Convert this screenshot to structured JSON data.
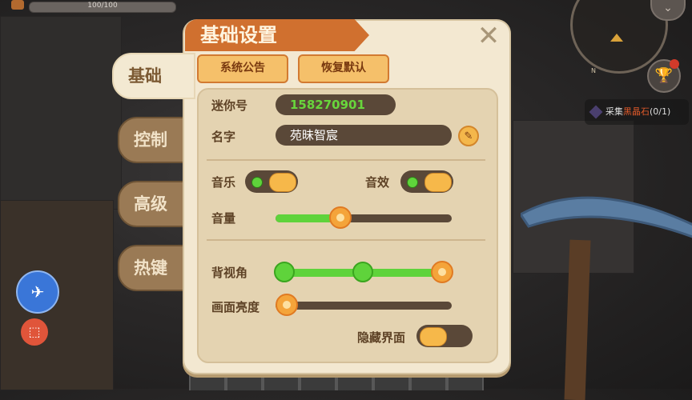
{
  "hud": {
    "health_text": "100/100",
    "compass_label": "N",
    "quest": {
      "prefix": "采集",
      "item": "黑晶石",
      "progress": "(0/1)"
    }
  },
  "tabs": [
    {
      "label": "基础",
      "active": true
    },
    {
      "label": "控制",
      "active": false
    },
    {
      "label": "高级",
      "active": false
    },
    {
      "label": "热键",
      "active": false
    }
  ],
  "panel": {
    "title": "基础设置",
    "buttons": {
      "announcement": "系统公告",
      "restore_default": "恢复默认"
    },
    "mini_id": {
      "label": "迷你号",
      "value": "158270901"
    },
    "name": {
      "label": "名字",
      "value": "苑昧智宸"
    },
    "music": {
      "label": "音乐",
      "on": true
    },
    "sound_effect": {
      "label": "音效",
      "on": true
    },
    "volume": {
      "label": "音量",
      "level": 0.35
    },
    "back_view": {
      "label": "背视角",
      "options": 3,
      "selected": 3
    },
    "brightness": {
      "label": "画面亮度",
      "level": 0.0
    },
    "hide_ui": {
      "label": "隐藏界面",
      "on": false
    }
  },
  "colors": {
    "accent_orange": "#d0702f",
    "panel_bg": "#f3e8d1",
    "toggle_green": "#5fd33b",
    "mini_id_green": "#68d63c"
  },
  "icons": [
    "close-icon",
    "edit-pencil-icon",
    "trophy-icon",
    "compass-icon",
    "screen-record-icon",
    "qq-bubble-icon",
    "gem-icon"
  ]
}
